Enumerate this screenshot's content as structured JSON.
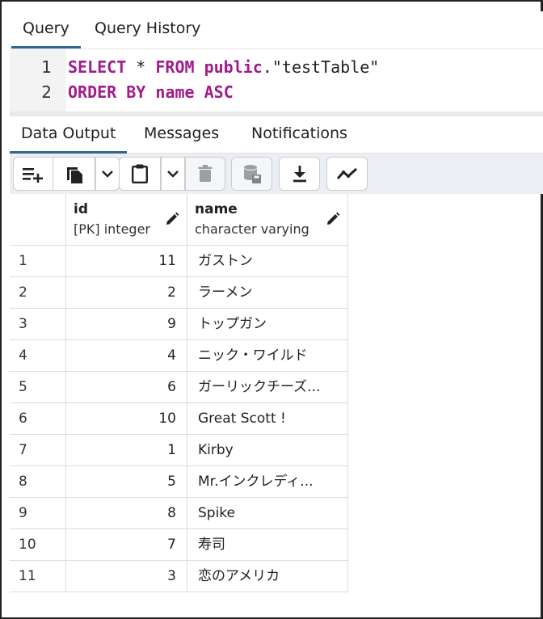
{
  "query_tabs": [
    {
      "label": "Query"
    },
    {
      "label": "Query History"
    }
  ],
  "editor": {
    "line_numbers": [
      "1",
      "2"
    ],
    "line1": {
      "kw1": "SELECT",
      "star": " * ",
      "kw2": "FROM",
      "sp": " ",
      "kw3": "public",
      "rest": ".\"testTable\""
    },
    "line2": {
      "kw1": "ORDER",
      "sp1": " ",
      "kw2": "BY",
      "sp2": " ",
      "kw3": "name",
      "sp3": " ",
      "kw4": "ASC"
    }
  },
  "result_tabs": [
    {
      "label": "Data Output"
    },
    {
      "label": "Messages"
    },
    {
      "label": "Notifications"
    }
  ],
  "toolbar": {
    "icons": [
      "add-row-icon",
      "copy-icon",
      "chevron-down-icon",
      "paste-icon",
      "chevron-down-icon",
      "delete-icon",
      "save-data-icon",
      "download-icon",
      "graph-icon"
    ]
  },
  "grid": {
    "columns": [
      {
        "name": "id",
        "type": "[PK] integer"
      },
      {
        "name": "name",
        "type": "character varying"
      }
    ],
    "rows": [
      {
        "rn": "1",
        "id": "11",
        "name": "ガストン"
      },
      {
        "rn": "2",
        "id": "2",
        "name": "ラーメン"
      },
      {
        "rn": "3",
        "id": "9",
        "name": "トップガン"
      },
      {
        "rn": "4",
        "id": "4",
        "name": "ニック・ワイルド"
      },
      {
        "rn": "5",
        "id": "6",
        "name": "ガーリックチーズ..."
      },
      {
        "rn": "6",
        "id": "10",
        "name": "Great Scott !"
      },
      {
        "rn": "7",
        "id": "1",
        "name": "Kirby"
      },
      {
        "rn": "8",
        "id": "5",
        "name": "Mr.インクレディ..."
      },
      {
        "rn": "9",
        "id": "8",
        "name": "Spike"
      },
      {
        "rn": "10",
        "id": "7",
        "name": "寿司"
      },
      {
        "rn": "11",
        "id": "3",
        "name": "恋のアメリカ"
      }
    ]
  },
  "colors": {
    "accent": "#326690",
    "keyword": "#a01c8c"
  }
}
